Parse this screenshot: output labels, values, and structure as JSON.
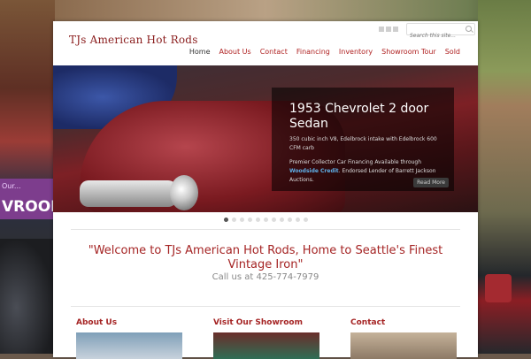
{
  "background": {
    "left_sign_small": "Our...",
    "left_sign_big": "VROOM"
  },
  "header": {
    "logo": "TJs American Hot Rods",
    "search_placeholder": "Search this site..."
  },
  "nav": {
    "items": [
      "Home",
      "About Us",
      "Contact",
      "Financing",
      "Inventory",
      "Showroom Tour",
      "Sold"
    ],
    "active": "Home"
  },
  "slider": {
    "title": "1953 Chevrolet 2 door Sedan",
    "spec": "350 cubic inch V8, Edelbrock intake with Edelbrock 600 CFM carb",
    "financing_prefix": "Premier Collector Car Financing Available through",
    "financing_link": "Woodside Credit",
    "financing_suffix": ". Endorsed Lender of Barrett Jackson Auctions.",
    "more_label": "Read More",
    "slide_count": 11,
    "current_slide": 1
  },
  "welcome": {
    "headline": "\"Welcome to TJs American Hot Rods, Home to Seattle's Finest Vintage Iron\"",
    "call": "Call us at 425-774-7979"
  },
  "columns": [
    {
      "title": "About Us"
    },
    {
      "title": "Visit Our Showroom"
    },
    {
      "title": "Contact"
    }
  ],
  "colors": {
    "brand_red": "#a52424",
    "link_blue": "#5fb0e8"
  }
}
